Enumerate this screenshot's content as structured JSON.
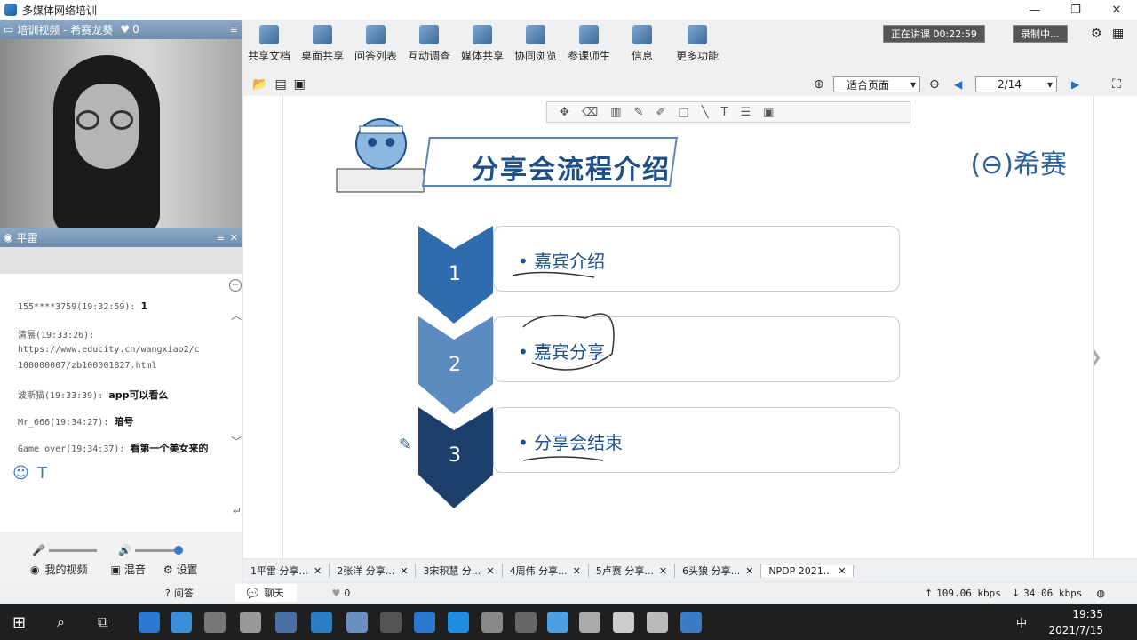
{
  "window": {
    "title": "多媒体网络培训"
  },
  "left_panel": {
    "video_title": "培训视频 - 希赛龙葵",
    "video_count": "0",
    "cam2_title": "平雷",
    "messages": [
      {
        "meta": "155****3759(19:32:59):",
        "text": "1"
      },
      {
        "meta": "清晨(19:33:26):",
        "text": ""
      },
      {
        "meta": "https://www.educity.cn/wangxiao2/c",
        "text": ""
      },
      {
        "meta": "100000007/zb100001827.html",
        "text": ""
      },
      {
        "meta": "波斯猫(19:33:39):",
        "text": "app可以看么"
      },
      {
        "meta": "Mr_666(19:34:27):",
        "text": "暗号"
      },
      {
        "meta": "Game over(19:34:37):",
        "text": "看第一个美女来的"
      }
    ],
    "my_video": "我的视频",
    "mix": "混音",
    "settings": "设置",
    "qa": "问答",
    "chat": "聊天",
    "like_count": "0"
  },
  "toolbar": {
    "items": [
      "共享文档",
      "桌面共享",
      "问答列表",
      "互动调查",
      "媒体共享",
      "协同浏览",
      "参课师生",
      "信息",
      "更多功能"
    ],
    "live_status": "正在讲课 00:22:59",
    "record_status": "录制中..."
  },
  "docbar": {
    "zoom": "适合页面",
    "page": "2/14"
  },
  "slide": {
    "title": "分享会流程介绍",
    "brand": "希赛",
    "steps": [
      {
        "num": "1",
        "label": "嘉宾介绍"
      },
      {
        "num": "2",
        "label": "嘉宾分享"
      },
      {
        "num": "3",
        "label": "分享会结束"
      }
    ]
  },
  "tabs": [
    "1平雷 分享...",
    "2张洋 分享...",
    "3宋积慧 分...",
    "4周伟 分享...",
    "5卢赛 分享...",
    "6头狼 分享...",
    "NPDP 2021..."
  ],
  "status": {
    "up": "109.06 kbps",
    "down": "34.06 kbps"
  },
  "clock": {
    "time": "19:35",
    "date": "2021/7/15"
  },
  "ime": "中",
  "colors": {
    "step1": "#2e6cad",
    "step2": "#5c8bc0",
    "step3": "#1d3f6b"
  }
}
